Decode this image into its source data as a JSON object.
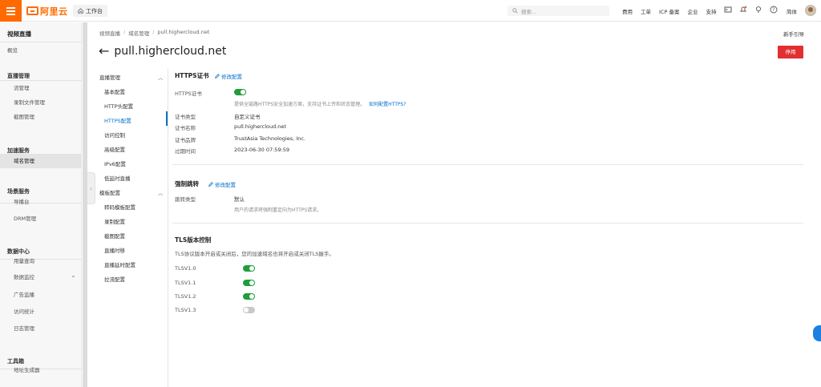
{
  "topbar": {
    "logo_text": "阿里云",
    "workbench": "工作台",
    "search_placeholder": "搜索...",
    "links": [
      "费用",
      "工单",
      "ICP 备案",
      "企业",
      "支持"
    ],
    "lang": "简体",
    "accent": "#ff6a00"
  },
  "sidebar": {
    "title": "视频直播",
    "overview": "概览",
    "groups": [
      {
        "label": "直播管理",
        "items": [
          "流管理",
          "录制文件管理",
          "截图管理"
        ]
      },
      {
        "label": "加速服务",
        "items": [
          "域名管理"
        ]
      },
      {
        "label": "场景服务",
        "items": [
          "导播台",
          "DRM管理"
        ]
      },
      {
        "label": "数据中心",
        "items": [
          "用量查询",
          "数据监控",
          "广告监播",
          "访问统计",
          "日志管理"
        ]
      },
      {
        "label": "工具箱",
        "items": [
          "地址生成器"
        ]
      }
    ],
    "active_item": "域名管理"
  },
  "breadcrumb": [
    "视频直播",
    "域名管理",
    "pull.highercloud.net"
  ],
  "newbie_guide": "新手引导",
  "page_title": "pull.highercloud.net",
  "stop_button": "停用",
  "confnav": {
    "groups": [
      {
        "label": "直播管理",
        "items": [
          "基本配置",
          "HTTP头配置",
          "HTTPS配置",
          "访问控制",
          "高级配置",
          "IPv6配置",
          "低延时直播"
        ]
      },
      {
        "label": "模板配置",
        "items": [
          "转码模板配置",
          "录制配置",
          "截图配置",
          "直播时移",
          "直播延时配置",
          "拉流配置"
        ]
      }
    ],
    "active_item": "HTTPS配置"
  },
  "https": {
    "section_title": "HTTPS证书",
    "edit_label": "修改配置",
    "switch_label": "HTTPS证书",
    "switch_on": true,
    "hint": "提供全链路HTTPS安全加速方案，支持证书上传和状态管理。",
    "hint_link": "如何配置HTTPS?",
    "rows": [
      {
        "label": "证书类型",
        "value": "自定义证书"
      },
      {
        "label": "证书名称",
        "value": "pull.highercloud.net"
      },
      {
        "label": "证书品牌",
        "value": "TrustAsia Technologies, Inc."
      },
      {
        "label": "过期时间",
        "value": "2023-06-30 07:59:59"
      }
    ]
  },
  "redirect": {
    "section_title": "强制跳转",
    "edit_label": "修改配置",
    "label": "跳转类型",
    "value": "默认",
    "hint": "用户的请求将强制重定向为HTTPS请求。"
  },
  "tls": {
    "section_title": "TLS版本控制",
    "desc": "TLS协议版本开启或关闭后，您的加速域名也将开启或关闭TLS握手。",
    "versions": [
      {
        "label": "TLSV1.0",
        "on": true
      },
      {
        "label": "TLSV1.1",
        "on": true
      },
      {
        "label": "TLSV1.2",
        "on": true
      },
      {
        "label": "TLSV1.3",
        "on": false
      }
    ]
  }
}
